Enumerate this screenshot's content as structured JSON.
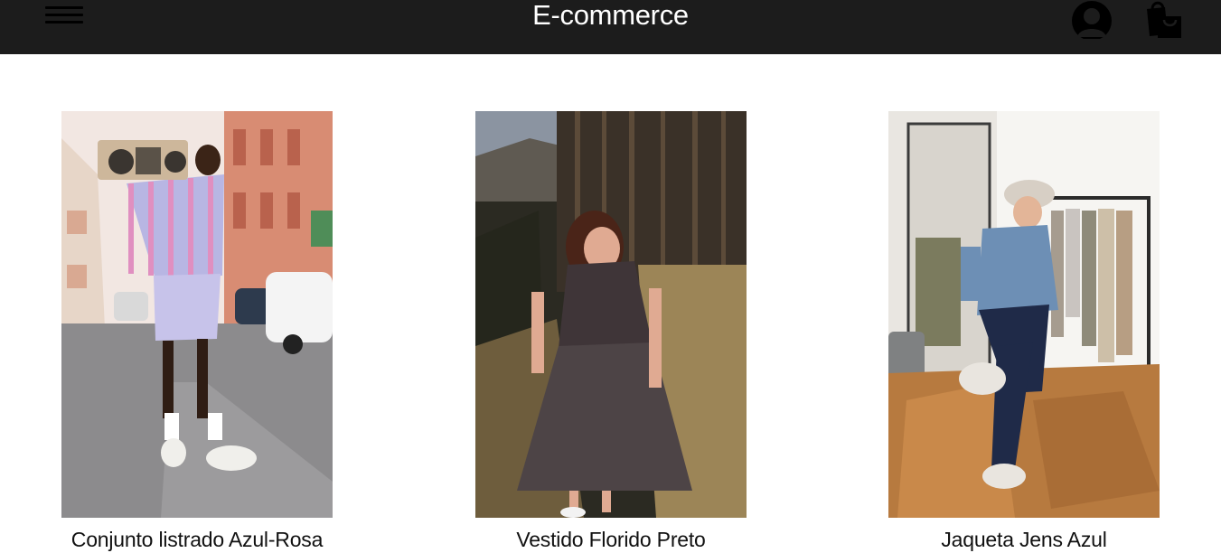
{
  "header": {
    "title": "E-commerce",
    "background_color": "#1c1c1c",
    "icons": [
      "menu-icon",
      "user-account-icon",
      "shopping-bag-icon"
    ]
  },
  "products": [
    {
      "name": "Conjunto listrado Azul-Rosa"
    },
    {
      "name": "Vestido Florido Preto"
    },
    {
      "name": "Jaqueta Jens Azul"
    }
  ]
}
